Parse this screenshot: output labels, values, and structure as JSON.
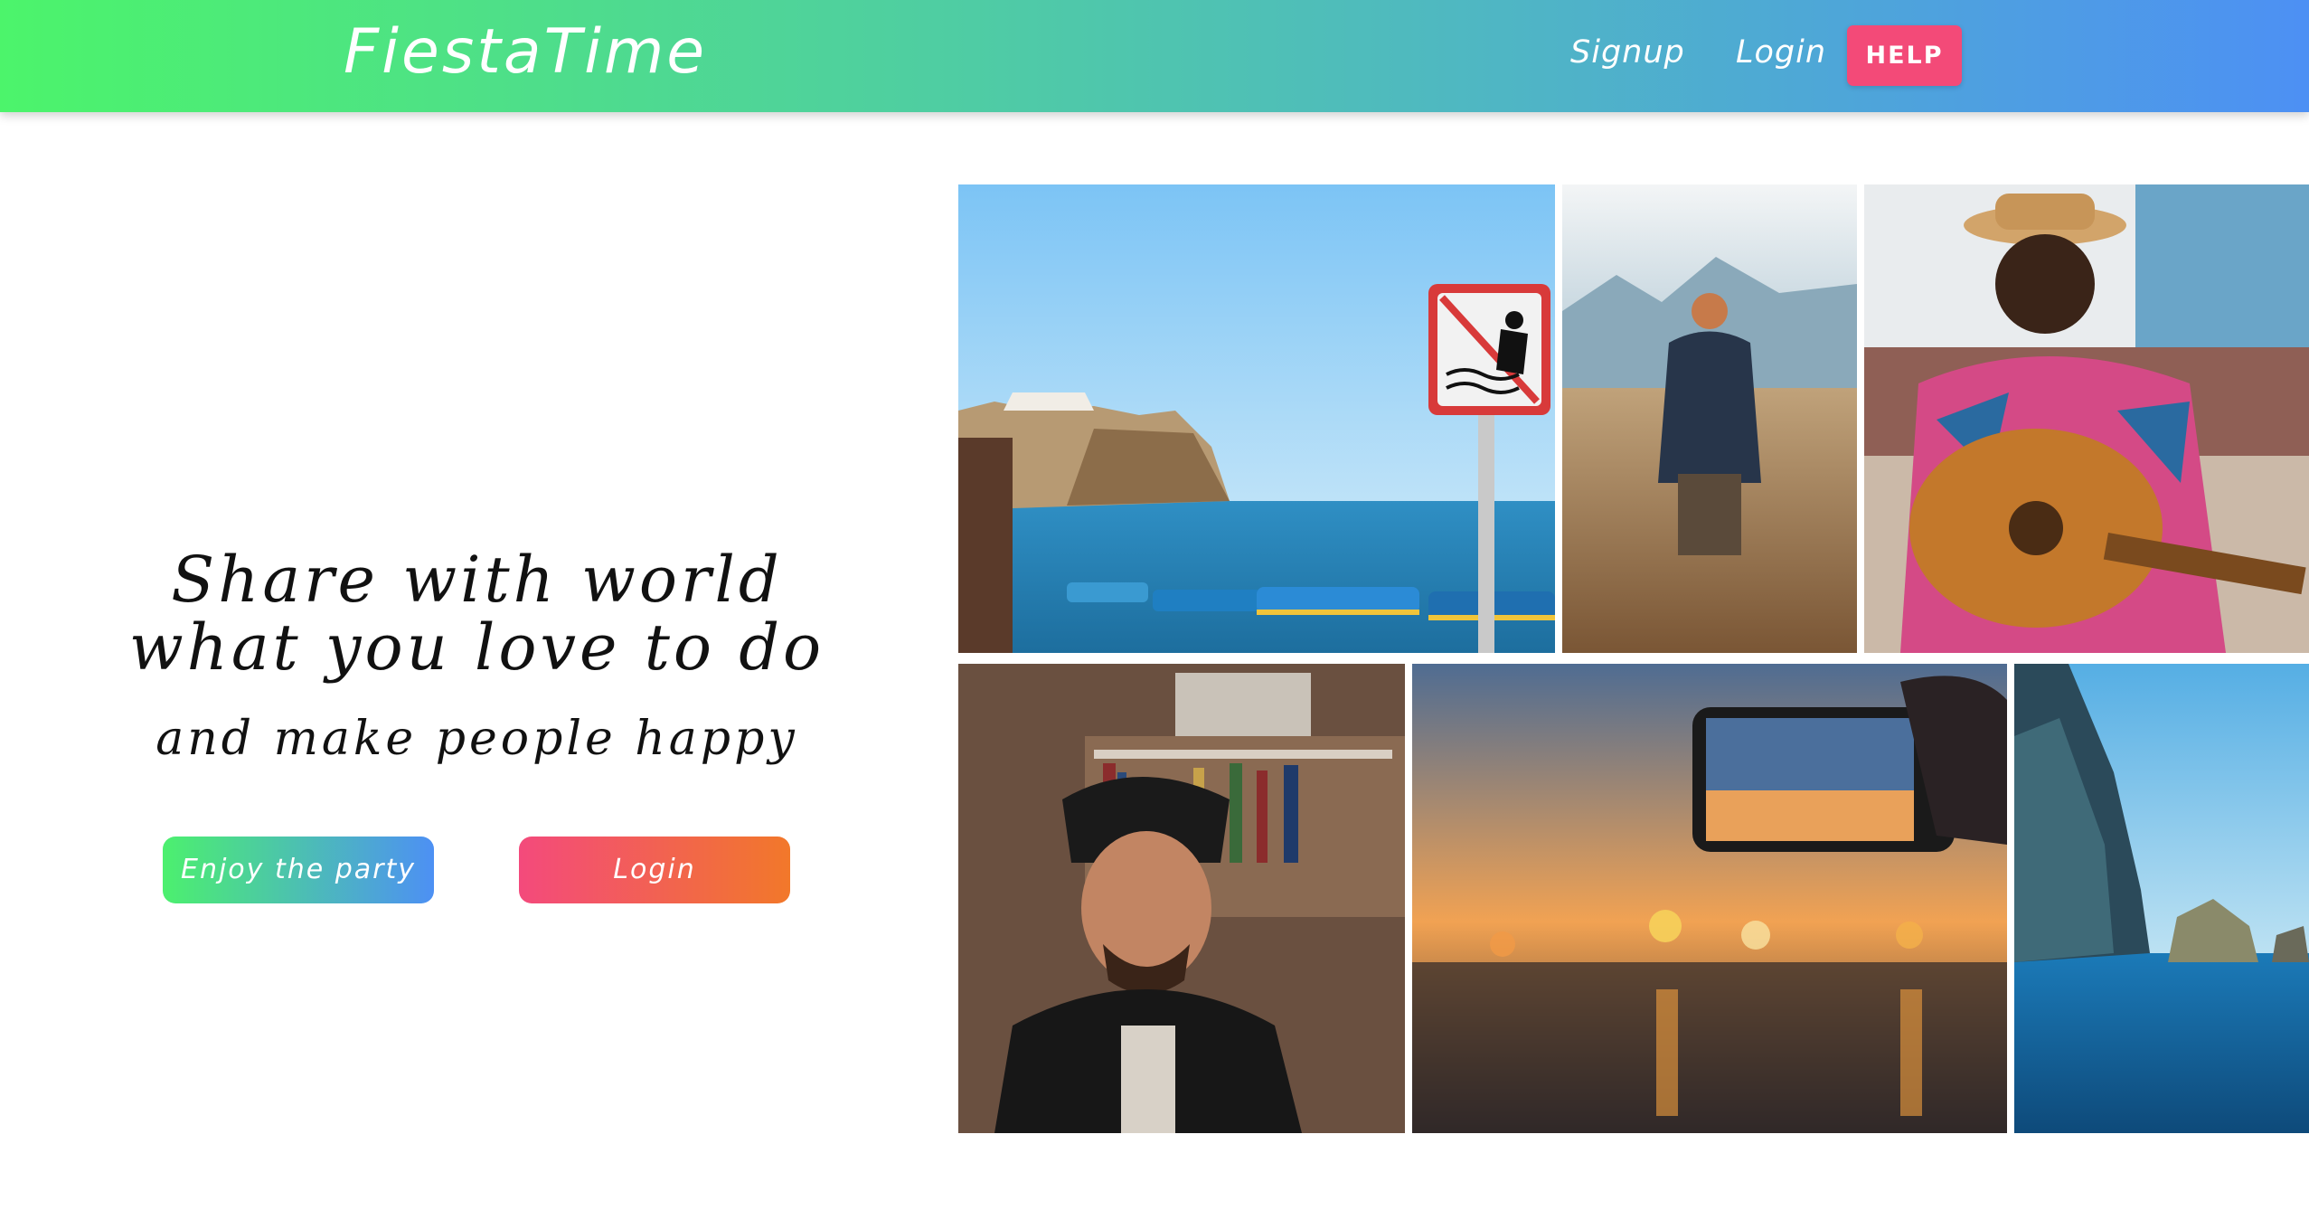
{
  "header": {
    "brand": "FiestaTime",
    "nav": {
      "signup": "Signup",
      "login": "Login",
      "help": "HELP"
    }
  },
  "hero": {
    "title_line1": "Share with world",
    "title_line2": "what you love to do",
    "subtitle": "and make people happy",
    "cta_primary": "Enjoy the party",
    "cta_secondary": "Login"
  },
  "colors": {
    "header_gradient": [
      "#4cf46b",
      "#4d90f4"
    ],
    "help_button": "#f34a78",
    "party_gradient": [
      "#4cf06e",
      "#4d90f4"
    ],
    "login_gradient": [
      "#f34a7c",
      "#f2782a"
    ]
  },
  "gallery": {
    "photos": [
      {
        "name": "harbor-boats-photo"
      },
      {
        "name": "man-in-field-photo"
      },
      {
        "name": "guitar-player-photo"
      },
      {
        "name": "man-with-turban-photo"
      },
      {
        "name": "phone-sunset-photo"
      },
      {
        "name": "sea-cliff-photo"
      }
    ]
  }
}
